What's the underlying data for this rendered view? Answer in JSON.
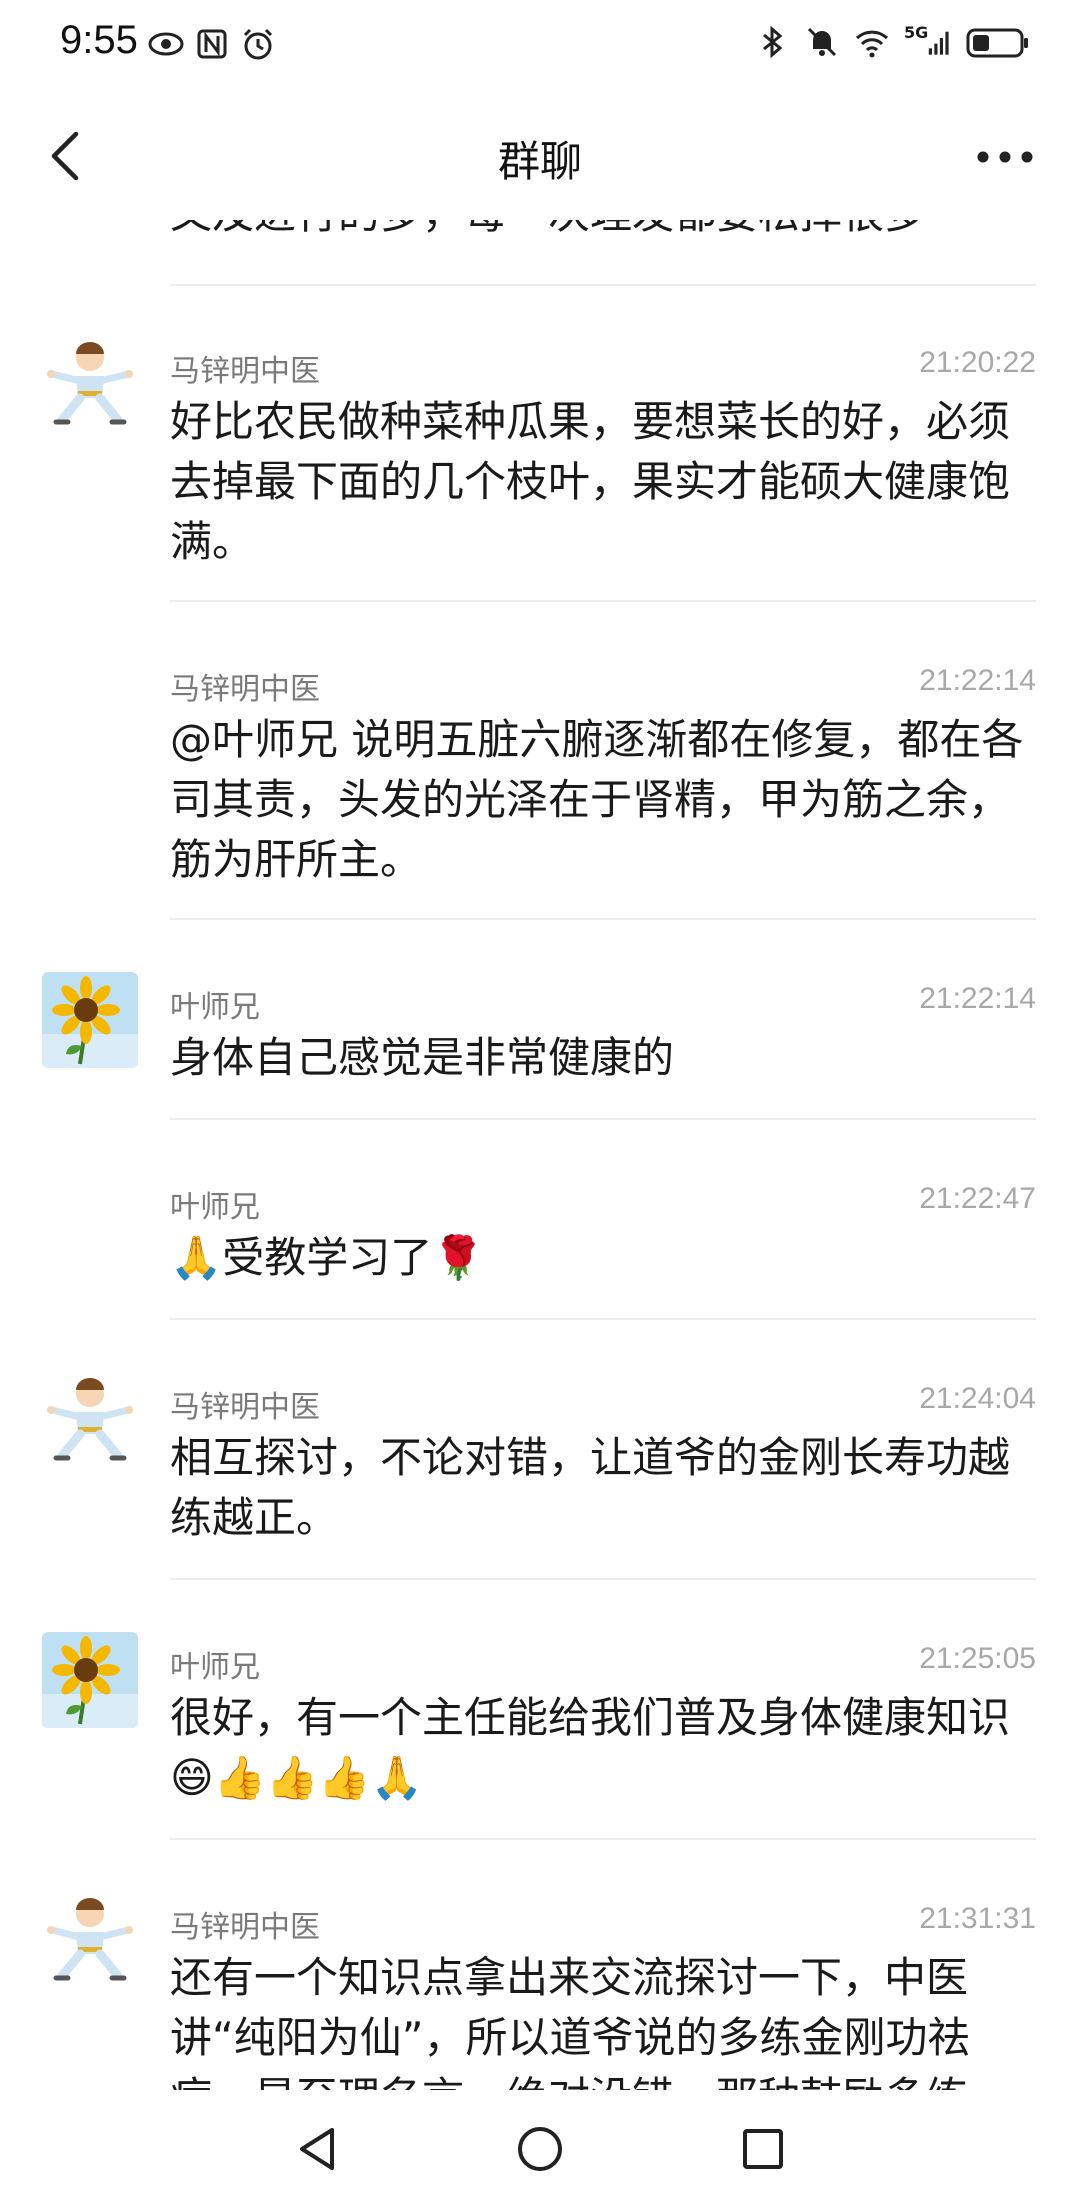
{
  "status_bar": {
    "time": "9:55",
    "network_badge": "5G",
    "icons": [
      "eye-icon",
      "nfc-icon",
      "alarm-icon",
      "bluetooth-icon",
      "mute-icon",
      "wifi-icon",
      "signal-icon",
      "battery-icon"
    ]
  },
  "header": {
    "title": "群聊",
    "back_icon": "chevron-left-icon",
    "more_icon": "more-icon"
  },
  "chat": {
    "clipped_top_text": "又及进行的多，每一次理发都要松掉很多",
    "messages": [
      {
        "sender": "马锌明中医",
        "time": "21:20:22",
        "text": "好比农民做种菜种瓜果，要想菜长的好，必须去掉最下面的几个枝叶，果实才能硕大健康饱满。",
        "avatar": "kungfu"
      },
      {
        "sender": "马锌明中医",
        "time": "21:22:14",
        "text": "@叶师兄 说明五脏六腑逐渐都在修复，都在各司其责，头发的光泽在于肾精，甲为筋之余，筋为肝所主。",
        "avatar": ""
      },
      {
        "sender": "叶师兄",
        "time": "21:22:14",
        "text": "身体自己感觉是非常健康的",
        "avatar": "sunflower"
      },
      {
        "sender": "叶师兄",
        "time": "21:22:47",
        "text": "🙏受教学习了🌹",
        "avatar": ""
      },
      {
        "sender": "马锌明中医",
        "time": "21:24:04",
        "text": "相互探讨，不论对错，让道爷的金刚长寿功越练越正。",
        "avatar": "kungfu"
      },
      {
        "sender": "叶师兄",
        "time": "21:25:05",
        "text": "很好，有一个主任能给我们普及身体健康知识😄👍👍👍🙏",
        "avatar": "sunflower"
      },
      {
        "sender": "马锌明中医",
        "time": "21:31:31",
        "text": "还有一个知识点拿出来交流探讨一下，中医讲“纯阳为仙”，所以道爷说的多练金刚功祛病，是至理名言，绝对没错，那种鼓励多练",
        "avatar": "kungfu"
      }
    ]
  },
  "nav_bar": {
    "icons": [
      "back-triangle-icon",
      "home-circle-icon",
      "recents-square-icon"
    ]
  },
  "colors": {
    "background": "#ffffff",
    "sender_gray": "#7a7a7a",
    "time_gray": "#a8a8a8",
    "divider": "#ececec"
  }
}
